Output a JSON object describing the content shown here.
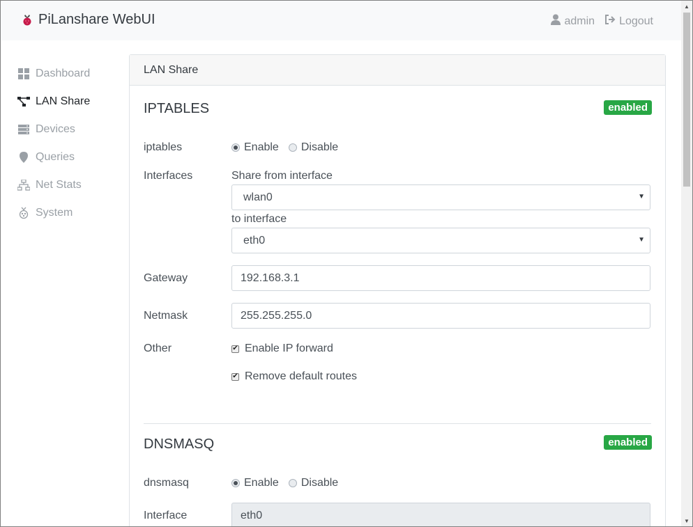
{
  "navbar": {
    "brand": "PiLanshare WebUI",
    "user": "admin",
    "logout": "Logout"
  },
  "sidebar": {
    "items": [
      {
        "label": "Dashboard",
        "icon": "dashboard-icon"
      },
      {
        "label": "LAN Share",
        "icon": "network-tree-icon",
        "active": true
      },
      {
        "label": "Devices",
        "icon": "server-icon"
      },
      {
        "label": "Queries",
        "icon": "location-pin-icon"
      },
      {
        "label": "Net Stats",
        "icon": "sitemap-icon"
      },
      {
        "label": "System",
        "icon": "raspberry-icon"
      }
    ]
  },
  "card": {
    "header": "LAN Share",
    "iptables": {
      "title": "IPTABLES",
      "badge": "enabled",
      "iptables_label": "iptables",
      "enable_label": "Enable",
      "disable_label": "Disable",
      "interfaces_label": "Interfaces",
      "share_from_label": "Share from interface",
      "share_from_value": "wlan0",
      "to_interface_label": "to interface",
      "to_interface_value": "eth0",
      "gateway_label": "Gateway",
      "gateway_value": "192.168.3.1",
      "netmask_label": "Netmask",
      "netmask_value": "255.255.255.0",
      "other_label": "Other",
      "ip_forward_label": "Enable IP forward",
      "remove_routes_label": "Remove default routes"
    },
    "dnsmasq": {
      "title": "DNSMASQ",
      "badge": "enabled",
      "dnsmasq_label": "dnsmasq",
      "enable_label": "Enable",
      "disable_label": "Disable",
      "interface_label": "Interface",
      "interface_value": "eth0"
    }
  },
  "colors": {
    "badge": "#28a745",
    "raspberry": "#c51a4a"
  }
}
